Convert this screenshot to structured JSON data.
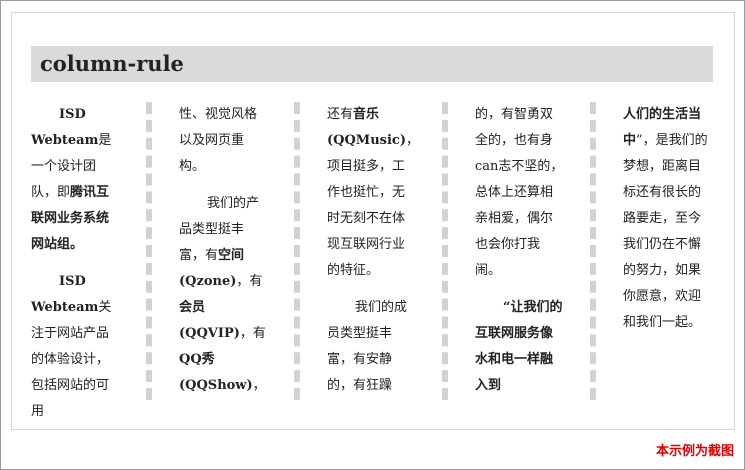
{
  "title": "column-rule",
  "caption": "本示例为截图",
  "columns": [
    [
      [
        "ind",
        [
          [
            "b",
            "ISD Webteam"
          ],
          [
            "t",
            "是一个设计团队，即"
          ],
          [
            "b",
            "腾讯互联网业务系统网站组。"
          ]
        ]
      ],
      [
        "ind",
        [
          [
            "b",
            "ISD Webteam"
          ],
          [
            "t",
            "关注于网站产品的体验设计，包括网站的可用"
          ]
        ]
      ]
    ],
    [
      [
        "cont",
        [
          [
            "t",
            "性、视觉风格以及网页重构。"
          ]
        ]
      ],
      [
        "ind",
        [
          [
            "t",
            "我们的产品类型挺丰富，有"
          ],
          [
            "b",
            "空间(Qzone)"
          ],
          [
            "t",
            "，有"
          ],
          [
            "b",
            "会员(QQVIP)"
          ],
          [
            "t",
            "，有"
          ],
          [
            "b",
            "QQ秀(QQShow)"
          ],
          [
            "t",
            "，"
          ]
        ]
      ]
    ],
    [
      [
        "cont",
        [
          [
            "t",
            "还有"
          ],
          [
            "b",
            "音乐(QQMusic)"
          ],
          [
            "t",
            "，项目挺多，工作也挺忙，无时无刻不在体现互联网行业的特征。"
          ]
        ]
      ],
      [
        "ind",
        [
          [
            "t",
            "我们的成员类型挺丰富，有安静的，有狂躁"
          ]
        ]
      ]
    ],
    [
      [
        "cont",
        [
          [
            "t",
            "的，有智勇双全的，也有身can志不坚的，总体上还算相亲相爱，偶尔也会你打我闹。"
          ]
        ]
      ],
      [
        "ind",
        [
          [
            "b",
            "“让我们的互联网服务像水和电一样融入到"
          ]
        ]
      ]
    ],
    [
      [
        "cont",
        [
          [
            "b",
            "人们的生活当中"
          ],
          [
            "t",
            "”，是我们的梦想，距离目标还有很长的路要走，至今我们仍在不懈的努力，如果你愿意，欢迎和我们一起。"
          ]
        ]
      ]
    ]
  ]
}
